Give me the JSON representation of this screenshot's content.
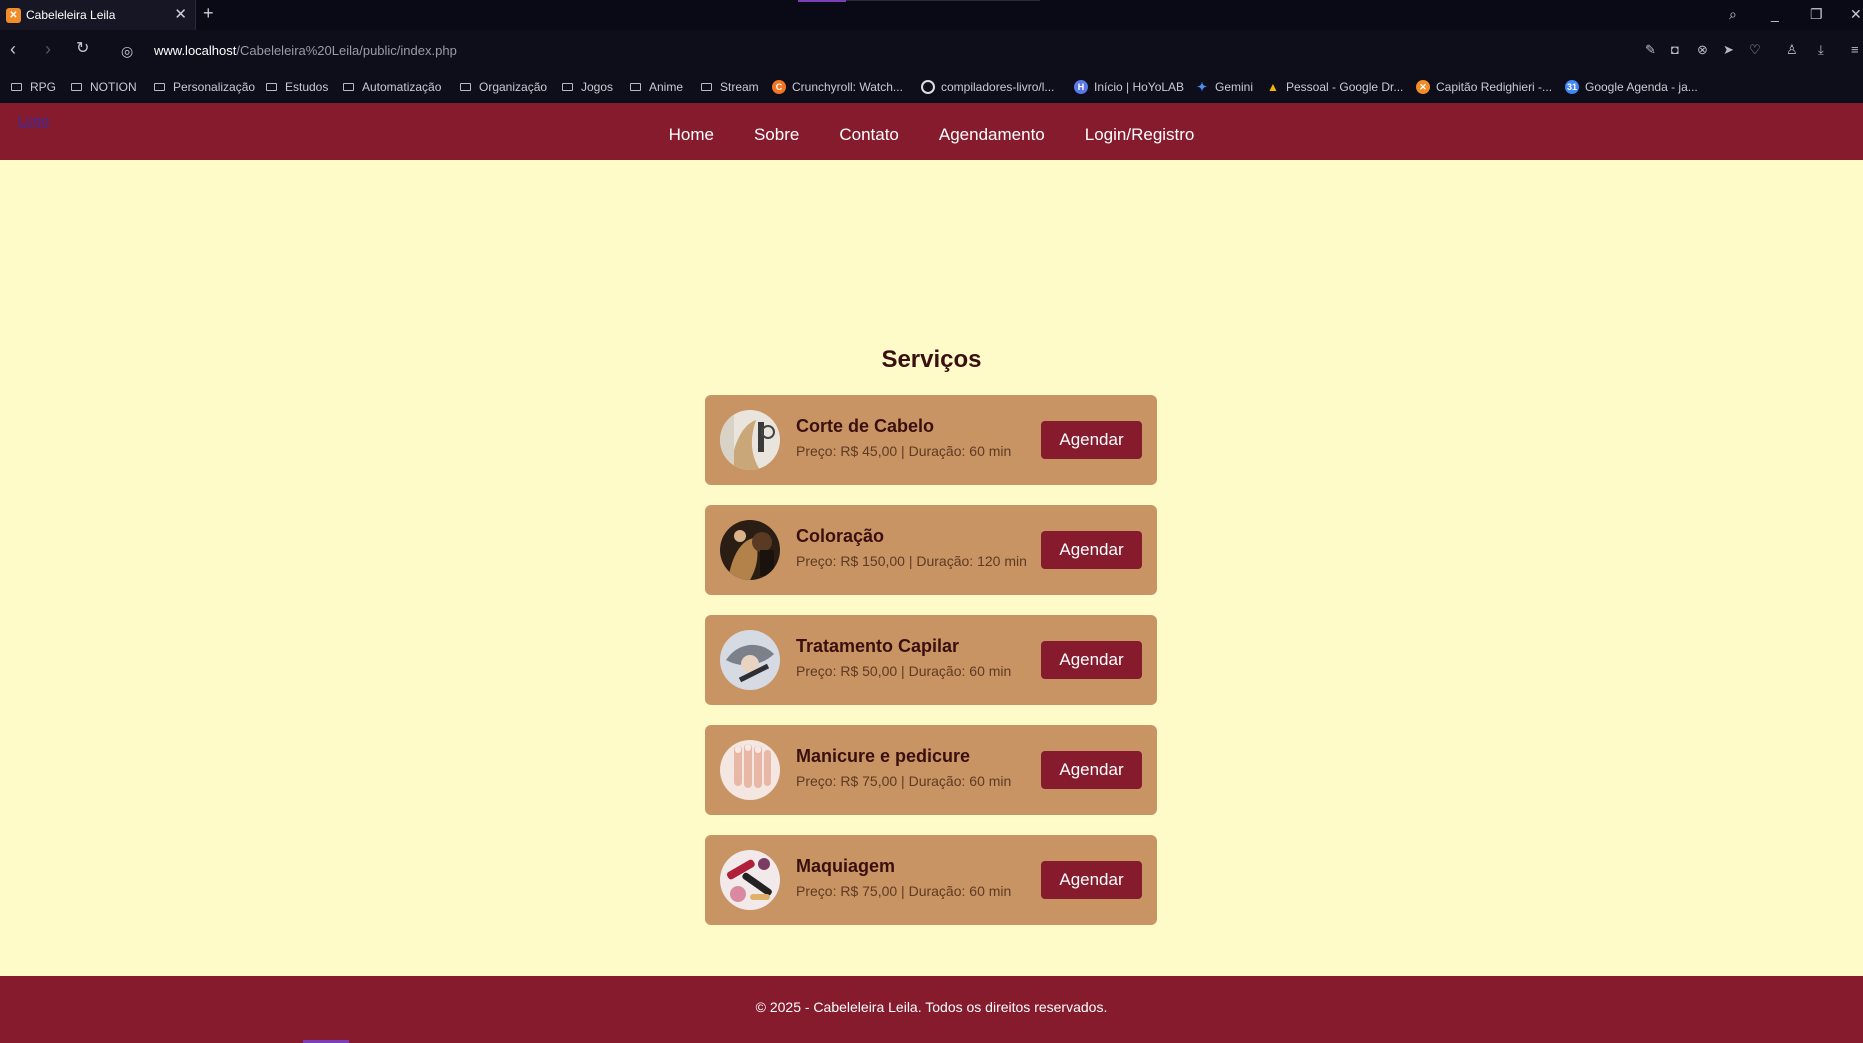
{
  "browser": {
    "tab_title": "Cabeleleira Leila",
    "url_host": "www.localhost",
    "url_path": "/Cabeleleira%20Leila/public/index.php",
    "bookmarks": [
      {
        "label": "RPG",
        "kind": "folder"
      },
      {
        "label": "NOTION",
        "kind": "folder"
      },
      {
        "label": "Personalização",
        "kind": "folder"
      },
      {
        "label": "Estudos",
        "kind": "folder"
      },
      {
        "label": "Automatização",
        "kind": "folder"
      },
      {
        "label": "Organização",
        "kind": "folder"
      },
      {
        "label": "Jogos",
        "kind": "folder"
      },
      {
        "label": "Anime",
        "kind": "folder"
      },
      {
        "label": "Stream",
        "kind": "folder"
      },
      {
        "label": "Crunchyroll: Watch...",
        "kind": "site"
      },
      {
        "label": "compiladores-livro/l...",
        "kind": "site"
      },
      {
        "label": "Início | HoYoLAB",
        "kind": "site"
      },
      {
        "label": "Gemini",
        "kind": "site"
      },
      {
        "label": "Pessoal - Google Dr...",
        "kind": "site"
      },
      {
        "label": "Capitão Redighieri -...",
        "kind": "site"
      },
      {
        "label": "Google Agenda - ja...",
        "kind": "site"
      }
    ]
  },
  "header": {
    "logo_text": "Logo",
    "nav": [
      "Home",
      "Sobre",
      "Contato",
      "Agendamento",
      "Login/Registro"
    ]
  },
  "main": {
    "section_title": "Serviços",
    "services": [
      {
        "name": "Corte de Cabelo",
        "meta": "Preço: R$ 45,00 | Duração: 60 min",
        "button": "Agendar"
      },
      {
        "name": "Coloração",
        "meta": "Preço: R$ 150,00 | Duração: 120 min",
        "button": "Agendar"
      },
      {
        "name": "Tratamento Capilar",
        "meta": "Preço: R$ 50,00 | Duração: 60 min",
        "button": "Agendar"
      },
      {
        "name": "Manicure e pedicure",
        "meta": "Preço: R$ 75,00 | Duração: 60 min",
        "button": "Agendar"
      },
      {
        "name": "Maquiagem",
        "meta": "Preço: R$ 75,00 | Duração: 60 min",
        "button": "Agendar"
      }
    ]
  },
  "footer": {
    "text": "© 2025 - Cabeleleira Leila. Todos os direitos reservados."
  },
  "colors": {
    "brand": "#861b2e",
    "page_bg": "#fffbc8",
    "card_bg": "#c99464",
    "heading": "#3a0f0f"
  }
}
